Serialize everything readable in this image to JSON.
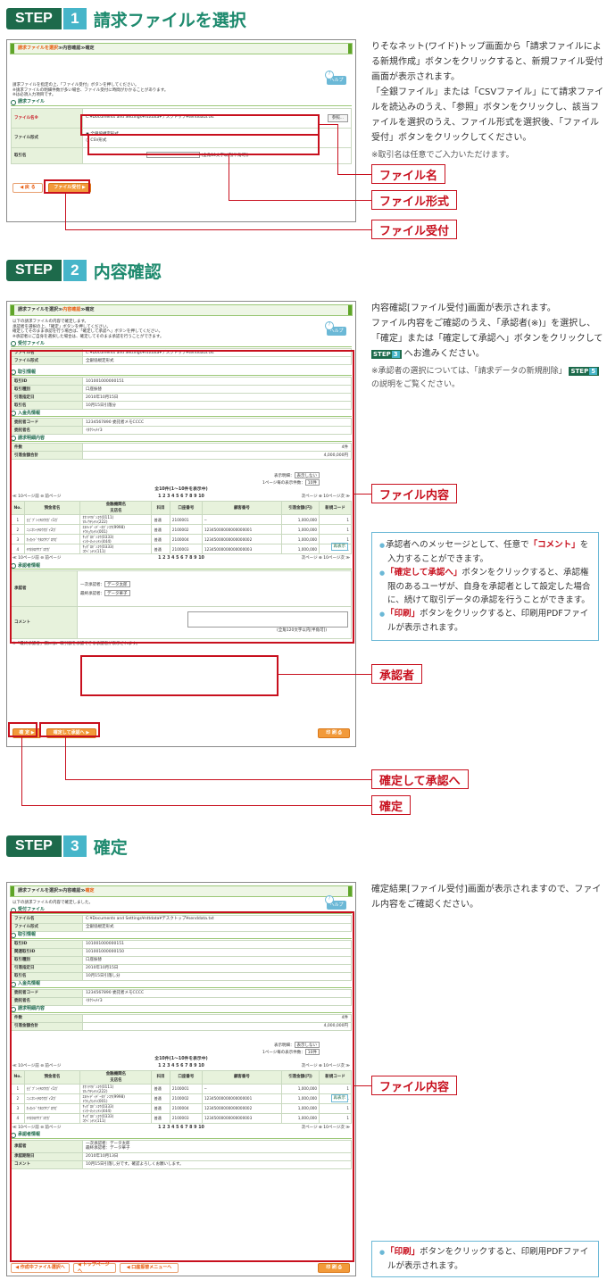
{
  "steps": [
    {
      "label": "STEP",
      "num": "1",
      "title": "請求ファイルを選択"
    },
    {
      "label": "STEP",
      "num": "2",
      "title": "内容確認"
    },
    {
      "label": "STEP",
      "num": "3",
      "title": "確定"
    }
  ],
  "breadcrumb": {
    "select": "請求ファイルを選択",
    "sep": " ≫ ",
    "confirm": "内容確認",
    "done": "確定"
  },
  "help": "ヘルプ",
  "s1": {
    "notes": [
      "請求ファイルを指定の上、「ファイル受付」ボタンを押してください。",
      "※請求ファイルの明細件数が多い場合、ファイル受付に時間がかかることがあります。",
      "※は必須入力項目です。"
    ],
    "section": "請求ファイル",
    "file_label": "ファイル名※",
    "file_value": "C:¥Documents and Settings¥nttdata¥デスクトップ¥senddata.txt",
    "browse": "参照...",
    "format_label": "ファイル形式",
    "format_opt1": "全銀協規定形式",
    "format_opt2": "CSV形式",
    "memo_label": "取引名",
    "memo_hint": "(全角10文字以内[半角可])",
    "back": "◀ 戻 る",
    "accept": "ファイル受付 ▶",
    "desc": [
      "りそなネット(ワイド)トップ画面から「請求ファイルによる新規作成」ボタンをクリックすると、新規ファイル受付画面が表示されます。",
      "「全銀ファイル」または「CSVファイル」にて請求ファイルを読込みのうえ、「参照」ボタンをクリックし、該当ファイルを選択のうえ、ファイル形式を選択後、「ファイル受付」ボタンをクリックしてください。"
    ],
    "footnote": "※取引名は任意でご入力いただけます。",
    "callouts": [
      "ファイル名",
      "ファイル形式",
      "ファイル受付"
    ]
  },
  "s2": {
    "notes": [
      "以下の請求ファイルの内容で確定します。",
      "承認者を選択の上、「確定」ボタンを押してください。",
      "確定してそのまま承認を行う場合は、「確定して承認へ」ボタンを押してください。",
      "※承認者にご自身を選択した場合は、確定してそのまま承認を行うことができます。"
    ],
    "sec_file": "受付ファイル",
    "sec_tx": "取引情報",
    "sec_payee": "入金先情報",
    "sec_detail": "請求明細内容",
    "sec_approver": "承認者情報",
    "file_rows": [
      [
        "ファイル名",
        "C:¥Documents and Settings¥nttdata¥デスクトップ¥senddata.txt"
      ],
      [
        "ファイル形式",
        "全銀協規定形式"
      ]
    ],
    "tx_rows": [
      [
        "取引ID",
        "101001000000151"
      ],
      [
        "取引種別",
        "口座振替"
      ],
      [
        "引落指定日",
        "2010年10月15日"
      ],
      [
        "取引名",
        "10月15日引落分"
      ]
    ],
    "payee_rows": [
      [
        "委託者コード",
        "1234567890 委託者メモCCCC"
      ],
      [
        "委託者名",
        "ｲﾀｸｼｬﾒｲ3"
      ]
    ],
    "detail_rows": [
      [
        "件数",
        "4件"
      ],
      [
        "引落金額合計",
        "4,000,000円"
      ]
    ],
    "display_label": "表示明細：",
    "display_value": "表示しない",
    "per_page_label": "1ページ毎の表示件数：",
    "per_page_value": "10件",
    "redisplay": "再表示",
    "range": "全10件(1〜10件を表示中)",
    "pages": "1 2 3 4 5 6 7 8 9 10",
    "prev10": "≪ 10ページ前",
    "prev": "前ページ",
    "next": "次ページ",
    "next10": "10ページ次 ≫",
    "headers": [
      "No.",
      "預金者名",
      "金融機関名\n支店名",
      "科目",
      "口座番号",
      "顧客番号",
      "引落金額(円)",
      "新規コード"
    ],
    "rows": [
      [
        "1",
        "ﾋﾋﾞﾌﾞﾝｲﾁﾛｳﾎｶﾞｲ1ｶﾞ",
        "ｵｵﾐﾔﾏｷﾞﾝｺｳ(0111)\nﾏﾙﾉｳﾁｼﾃﾝ(222)",
        "普通",
        "2100001",
        "─",
        "1,000,000",
        "1"
      ],
      [
        "2",
        "ﾆｼﾆﾎﾝｲﾁﾛｳﾎｶﾞｲ2ｶﾞ",
        "ｴﾇﾃｨﾃﾞｨﾃﾞｰﾀｷﾞﾝｺｳ(9998)\nﾄｳｷｮｳｼﾃﾝ(001)",
        "普通",
        "2100002",
        "12345000000000000001",
        "1,000,000",
        "1"
      ],
      [
        "3",
        "ﾎｯｶｲﾄﾞｳﾀﾛｳｻﾌﾞﾛｳｶﾞ",
        "ｻｯﾎﾟﾛｷﾞﾝｺｳ(0333)\nｲﾝﾀｰﾈｯﾄｼﾃﾝ(444)",
        "普通",
        "2100004",
        "12345000000000000002",
        "1,000,000",
        "1"
      ],
      [
        "4",
        "ﾔﾏﾈﾀﾛｳｻﾌﾞﾛｳｶﾞ",
        "ｻｯﾎﾟﾛｷﾞﾝｺｳ(0333)\nｺｳﾍﾞｼﾃﾝ(111)",
        "普通",
        "2100003",
        "12345000000000000003",
        "1,000,000",
        "1"
      ]
    ],
    "approver_label": "承認者",
    "approver1": "一次承認者：",
    "approver1_val": "データ太郎",
    "approver2": "最終承認者：",
    "approver2_val": "データ華子",
    "comment_label": "コメント",
    "comment_hint": "(全角120文字以内[半角可])",
    "approver_note": "※「最終承認者」欄には、取引額を承認できる承認者が表示されます。",
    "confirm_btn": "確 定 ▶",
    "confirm_approve_btn": "確定して承認へ ▶",
    "print_btn": "印 刷",
    "desc": [
      "内容確認[ファイル受付]画面が表示されます。",
      "ファイル内容をご確認のうえ、「承認者(※)」を選択し、「確定」または「確定して承認へ」ボタンをクリックして"
    ],
    "desc_tail": "へお進みください。",
    "footnote": "※承認者の選択については、「請求データの新規削除」",
    "footnote_tail": "の説明をご覧ください。",
    "info": [
      [
        "承認者へのメッセージとして、任意で",
        "「コメント」",
        "を入力することができます。"
      ],
      [
        "",
        "「確定して承認へ」",
        "ボタンをクリックすると、承認権限のあるユーザが、自身を承認者として設定した場合に、続けて取引データの承認を行うことができます。"
      ],
      [
        "",
        "「印刷」",
        "ボタンをクリックすると、印刷用PDFファイルが表示されます。"
      ]
    ],
    "callouts": [
      "ファイル内容",
      "承認者",
      "確定して承認へ",
      "確定"
    ]
  },
  "s3": {
    "notes": [
      "以下の請求ファイルの内容で確定しました。"
    ],
    "tx_rows": [
      [
        "取引ID",
        "101001000000151"
      ],
      [
        "関連取引ID",
        "101001000000150"
      ],
      [
        "取引種別",
        "口座振替"
      ],
      [
        "引落指定日",
        "2010年10月15日"
      ],
      [
        "取引名",
        "10月15日引落し分"
      ]
    ],
    "approver_rows": [
      [
        "承認者",
        "一次承認者：データ太郎\n最終承認者：データ華子"
      ],
      [
        "承認期限日",
        "2010年10月13日"
      ],
      [
        "コメント",
        "10月15日引落し分です。確認よろしくお願いします。"
      ]
    ],
    "buttons": [
      "◀ 作成中ファイル選択へ",
      "◀ トップページへ",
      "◀ 口座振替メニューへ"
    ],
    "desc": "確定結果[ファイル受付]画面が表示されますので、ファイル内容をご確認ください。",
    "info": [
      [
        "",
        "「印刷」",
        "ボタンをクリックすると、印刷用PDFファイルが表示されます。"
      ]
    ],
    "callout": "ファイル内容"
  }
}
